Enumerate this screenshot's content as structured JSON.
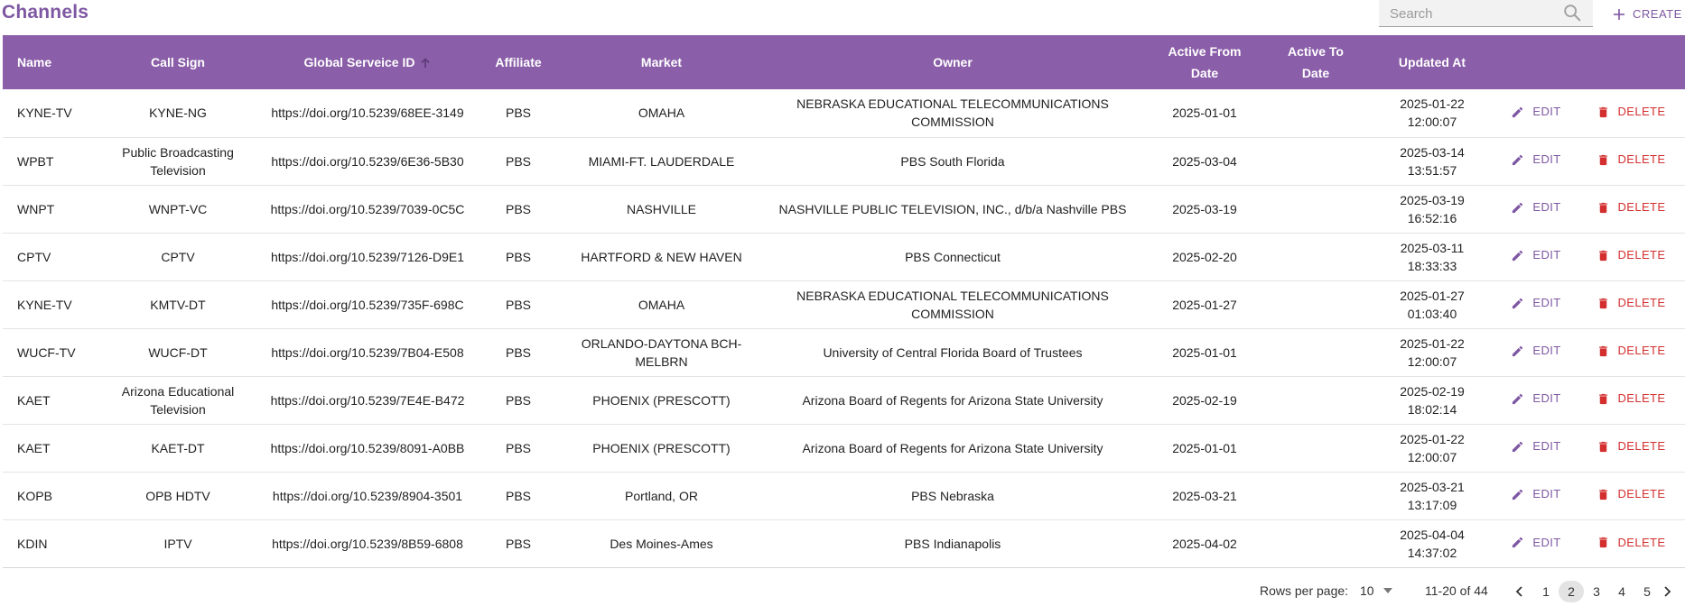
{
  "header": {
    "title": "Channels",
    "search_placeholder": "Search",
    "create_label": "CREATE"
  },
  "table": {
    "columns": [
      [
        "Name"
      ],
      [
        "Call Sign"
      ],
      [
        "Global Serveice ID"
      ],
      [
        "Affiliate"
      ],
      [
        "Market"
      ],
      [
        "Owner"
      ],
      [
        "Active From",
        "Date"
      ],
      [
        "Active To",
        "Date"
      ],
      [
        "Updated At"
      ]
    ],
    "rows": [
      {
        "name": "KYNE-TV",
        "call_sign": "KYNE-NG",
        "gsid": "https://doi.org/10.5239/68EE-3149",
        "affiliate": "PBS",
        "market": "OMAHA",
        "owner": "NEBRASKA EDUCATIONAL TELECOMMUNICATIONS COMMISSION",
        "active_from": "2025-01-01",
        "active_to": "",
        "updated_at": [
          "2025-01-22",
          "12:00:07"
        ]
      },
      {
        "name": "WPBT",
        "call_sign": "Public Broadcasting Television",
        "gsid": "https://doi.org/10.5239/6E36-5B30",
        "affiliate": "PBS",
        "market": "MIAMI-FT. LAUDERDALE",
        "owner": "PBS South Florida",
        "active_from": "2025-03-04",
        "active_to": "",
        "updated_at": [
          "2025-03-14",
          "13:51:57"
        ]
      },
      {
        "name": "WNPT",
        "call_sign": "WNPT-VC",
        "gsid": "https://doi.org/10.5239/7039-0C5C",
        "affiliate": "PBS",
        "market": "NASHVILLE",
        "owner": "NASHVILLE PUBLIC TELEVISION, INC., d/b/a Nashville PBS",
        "active_from": "2025-03-19",
        "active_to": "",
        "updated_at": [
          "2025-03-19",
          "16:52:16"
        ]
      },
      {
        "name": "CPTV",
        "call_sign": "CPTV",
        "gsid": "https://doi.org/10.5239/7126-D9E1",
        "affiliate": "PBS",
        "market": "HARTFORD & NEW HAVEN",
        "owner": "PBS Connecticut",
        "active_from": "2025-02-20",
        "active_to": "",
        "updated_at": [
          "2025-03-11",
          "18:33:33"
        ]
      },
      {
        "name": "KYNE-TV",
        "call_sign": "KMTV-DT",
        "gsid": "https://doi.org/10.5239/735F-698C",
        "affiliate": "PBS",
        "market": "OMAHA",
        "owner": "NEBRASKA EDUCATIONAL TELECOMMUNICATIONS COMMISSION",
        "active_from": "2025-01-27",
        "active_to": "",
        "updated_at": [
          "2025-01-27",
          "01:03:40"
        ]
      },
      {
        "name": "WUCF-TV",
        "call_sign": "WUCF-DT",
        "gsid": "https://doi.org/10.5239/7B04-E508",
        "affiliate": "PBS",
        "market": "ORLANDO-DAYTONA BCH-MELBRN",
        "owner": "University of Central Florida Board of Trustees",
        "active_from": "2025-01-01",
        "active_to": "",
        "updated_at": [
          "2025-01-22",
          "12:00:07"
        ]
      },
      {
        "name": "KAET",
        "call_sign": "Arizona Educational Television",
        "gsid": "https://doi.org/10.5239/7E4E-B472",
        "affiliate": "PBS",
        "market": "PHOENIX (PRESCOTT)",
        "owner": "Arizona Board of Regents for Arizona State University",
        "active_from": "2025-02-19",
        "active_to": "",
        "updated_at": [
          "2025-02-19",
          "18:02:14"
        ]
      },
      {
        "name": "KAET",
        "call_sign": "KAET-DT",
        "gsid": "https://doi.org/10.5239/8091-A0BB",
        "affiliate": "PBS",
        "market": "PHOENIX (PRESCOTT)",
        "owner": "Arizona Board of Regents for Arizona State University",
        "active_from": "2025-01-01",
        "active_to": "",
        "updated_at": [
          "2025-01-22",
          "12:00:07"
        ]
      },
      {
        "name": "KOPB",
        "call_sign": "OPB HDTV",
        "gsid": "https://doi.org/10.5239/8904-3501",
        "affiliate": "PBS",
        "market": "Portland, OR",
        "owner": "PBS Nebraska",
        "active_from": "2025-03-21",
        "active_to": "",
        "updated_at": [
          "2025-03-21",
          "13:17:09"
        ]
      },
      {
        "name": "KDIN",
        "call_sign": "IPTV",
        "gsid": "https://doi.org/10.5239/8B59-6808",
        "affiliate": "PBS",
        "market": "Des Moines-Ames",
        "owner": "PBS Indianapolis",
        "active_from": "2025-04-02",
        "active_to": "",
        "updated_at": [
          "2025-04-04",
          "14:37:02"
        ]
      }
    ],
    "edit_label": "EDIT",
    "delete_label": "DELETE"
  },
  "pagination": {
    "rows_per_page_label": "Rows per page:",
    "rows_per_page_value": "10",
    "range_text": "11-20 of 44",
    "pages": [
      "1",
      "2",
      "3",
      "4",
      "5"
    ],
    "current_page": "2"
  },
  "colors": {
    "accent": "#7e57a3",
    "header_bg": "#8a5ea8",
    "delete": "#d32f2f"
  },
  "icons": {
    "search": "search-icon",
    "create": "plus-icon",
    "sort": "arrow-up-icon",
    "edit": "pencil-icon",
    "delete": "trash-icon",
    "dropdown": "caret-down-icon",
    "prev": "chevron-left-icon",
    "next": "chevron-right-icon"
  }
}
